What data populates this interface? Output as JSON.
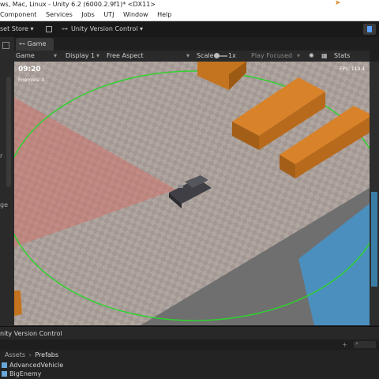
{
  "window": {
    "title": "ws, Mac, Linux - Unity 6.2 (6000.2.9f1)* <DX11>"
  },
  "menu": {
    "items": [
      "Component",
      "Services",
      "Jobs",
      "UTJ",
      "Window",
      "Help"
    ]
  },
  "toolbar": {
    "asset_store": "set Store ▾",
    "version_control": "Unity Version Control ▾"
  },
  "left_strip": {
    "fragments": [
      "r",
      "ge"
    ]
  },
  "game_tab": {
    "label": "Game"
  },
  "game_toolbar": {
    "mode": "Game",
    "display": "Display 1",
    "aspect": "Free Aspect",
    "scale_label": "Scale",
    "scale_value": "1x",
    "play_mode": "Play Focused",
    "stats": "Stats"
  },
  "hud": {
    "timer": "09:20",
    "enemies": "Enemies: 0",
    "fps": "FPS: 113.4"
  },
  "bottom_panel": {
    "header": "nity Version Control",
    "breadcrumb_root": "Assets",
    "breadcrumb_sep": "›",
    "breadcrumb_current": "Prefabs",
    "files": [
      "AdvancedVehicle",
      "BigEnemy"
    ]
  },
  "colors": {
    "accent_green": "#2fd12f",
    "crate_orange": "#c4741e",
    "vision_cone": "#d86a62",
    "water": "#4b8fbf"
  }
}
